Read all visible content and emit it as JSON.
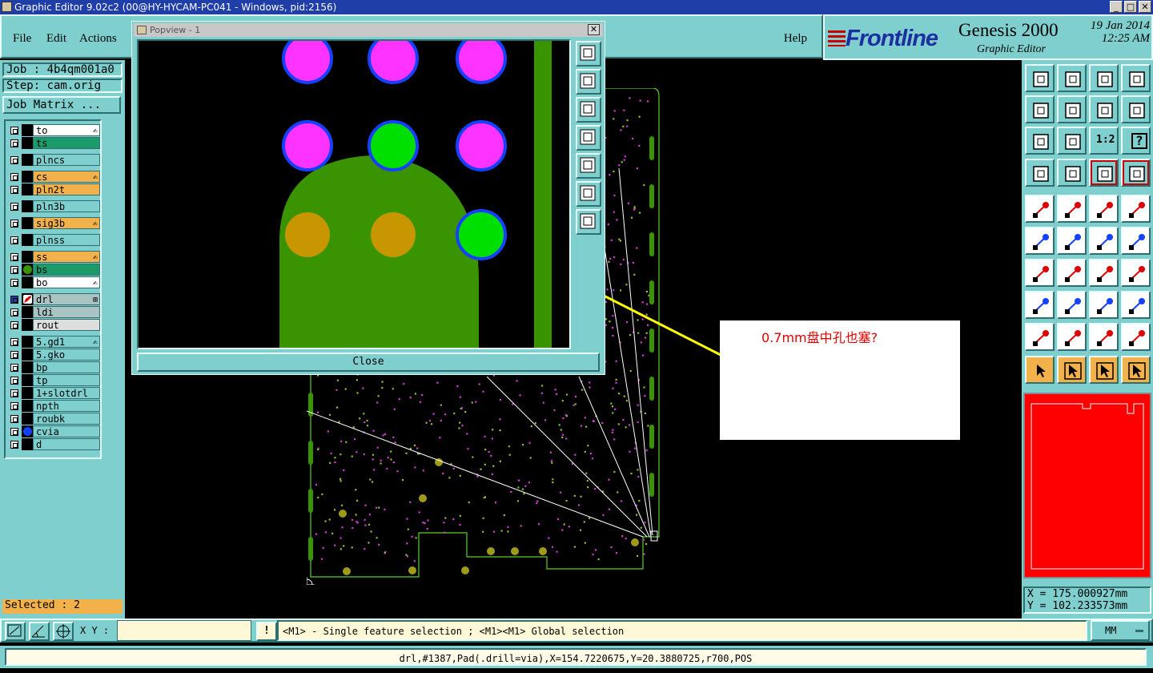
{
  "window": {
    "title": "Graphic Editor 9.02c2 (00@HY-HYCAM-PC041 - Windows, pid:2156)"
  },
  "menu": {
    "file": "File",
    "edit": "Edit",
    "actions": "Actions",
    "help": "Help"
  },
  "logo": {
    "brand": "Frontline",
    "product": "Genesis 2000",
    "subtitle": "Graphic Editor",
    "date": "19 Jan 2014",
    "time": "12:25 AM"
  },
  "job": {
    "job_line": "Job : 4b4qm001a0",
    "step_line": "Step: cam.orig",
    "matrix_button": "Job Matrix ..."
  },
  "layers": [
    {
      "name": "to",
      "style": "white",
      "mark": "✍"
    },
    {
      "name": "ts",
      "style": "green",
      "mark": ""
    },
    {
      "name": "plncs",
      "style": "teal",
      "mark": ""
    },
    {
      "name": "cs",
      "style": "orange",
      "mark": "✍"
    },
    {
      "name": "pln2t",
      "style": "orange",
      "mark": ""
    },
    {
      "name": "pln3b",
      "style": "teal",
      "mark": ""
    },
    {
      "name": "sig3b",
      "style": "orange",
      "mark": "✍"
    },
    {
      "name": "plnss",
      "style": "teal",
      "mark": ""
    },
    {
      "name": "ss",
      "style": "orange",
      "mark": "✍"
    },
    {
      "name": "bs",
      "style": "green",
      "mark": ""
    },
    {
      "name": "bo",
      "style": "white",
      "mark": "✍"
    },
    {
      "name": "drl",
      "style": "gray",
      "mark": "⊞"
    },
    {
      "name": "ldi",
      "style": "gray",
      "mark": ""
    },
    {
      "name": "rout",
      "style": "lightgray",
      "mark": ""
    },
    {
      "name": "5.gd1",
      "style": "teal",
      "mark": "✍"
    },
    {
      "name": "5.gko",
      "style": "teal",
      "mark": ""
    },
    {
      "name": "bp",
      "style": "teal",
      "mark": ""
    },
    {
      "name": "tp",
      "style": "teal",
      "mark": ""
    },
    {
      "name": "1+slotdrl",
      "style": "teal",
      "mark": ""
    },
    {
      "name": "npth",
      "style": "teal",
      "mark": ""
    },
    {
      "name": "roubk",
      "style": "teal",
      "mark": ""
    },
    {
      "name": "cvia",
      "style": "teal",
      "mark": ""
    },
    {
      "name": "d",
      "style": "teal",
      "mark": ""
    }
  ],
  "selection": {
    "selected_label": "Selected : 2"
  },
  "popview": {
    "title": "Popview - 1",
    "close_label": "Close"
  },
  "annotation": {
    "text": "0.7mm盘中孔也塞?"
  },
  "coords": {
    "x": "X = 175.000927mm",
    "y": "Y = 102.233573mm"
  },
  "bottom": {
    "xy_label": "X Y :",
    "xy_value": "",
    "hint": "<M1> - Single feature selection ; <M1><M1> Global selection",
    "units": "MM",
    "status": "drl,#1387,Pad(.drill=via),X=154.7220675,Y=20.3880725,r700,POS"
  },
  "toolbar": {
    "ratio_label": "1:2",
    "help_glyph": "?"
  },
  "colors": {
    "teal": "#7fcfcf",
    "board_green": "#3a9300",
    "magenta_pad": "#ff33ff",
    "green_pad": "#00e000",
    "amber_pad": "#c89600",
    "arrow": "#ffff00",
    "minimap": "#ff0000"
  }
}
